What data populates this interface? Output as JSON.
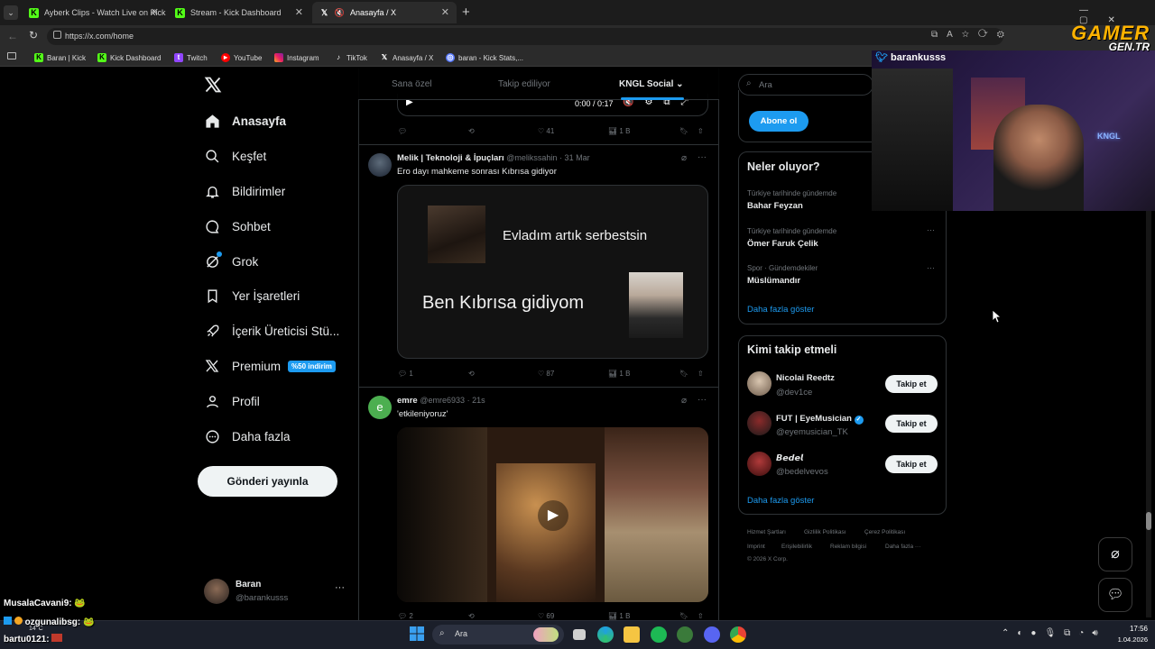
{
  "browser": {
    "tabs": [
      {
        "label": "Ayberk Clips - Watch Live on Kick",
        "favicon": "kick-icon",
        "color": "#53fc18"
      },
      {
        "label": "Stream - Kick Dashboard",
        "favicon": "kick-icon",
        "color": "#53fc18"
      },
      {
        "label": "Anasayfa / X",
        "favicon": "x-icon",
        "color": "#ffffff"
      }
    ],
    "url": "https://x.com/home",
    "bookmarks": [
      "Baran | Kick",
      "Kick Dashboard",
      "Twitch",
      "YouTube",
      "Instagram",
      "TikTok",
      "Anasayfa / X",
      "baran - Kick Stats,..."
    ]
  },
  "sidebar": {
    "items": [
      {
        "label": "Anasayfa",
        "icon": "home-icon"
      },
      {
        "label": "Keşfet",
        "icon": "search-icon"
      },
      {
        "label": "Bildirimler",
        "icon": "bell-icon"
      },
      {
        "label": "Sohbet",
        "icon": "chat-icon"
      },
      {
        "label": "Grok",
        "icon": "grok-icon"
      },
      {
        "label": "Yer İşaretleri",
        "icon": "bookmark-icon"
      },
      {
        "label": "İçerik Üreticisi Stü...",
        "icon": "rocket-icon"
      },
      {
        "label": "Premium",
        "icon": "x-icon"
      },
      {
        "label": "Profil",
        "icon": "user-icon"
      },
      {
        "label": "Daha fazla",
        "icon": "more-circle-icon"
      }
    ],
    "premium_badge": "%50 indirim",
    "post_button": "Gönderi yayınla",
    "account": {
      "name": "Baran",
      "handle": "@barankusss"
    }
  },
  "feed": {
    "tabs": [
      "Sana özel",
      "Takip ediliyor",
      "KNGL Social"
    ],
    "video_time": "0:00 / 0:17",
    "top_post_actions": {
      "likes": "41",
      "views": "1 B"
    },
    "posts": [
      {
        "name": "Melik | Teknoloji & İpuçları",
        "handle": "@melikssahin",
        "time": "· 31 Mar",
        "text": "Ero dayı mahkeme sonrası Kıbrısa gidiyor",
        "meme_line1": "Evladım artık serbestsin",
        "meme_line2": "Ben Kıbrısa gidiyom",
        "replies": "1",
        "likes": "87",
        "views": "1 B"
      },
      {
        "name": "emre",
        "handle": "@emre6933",
        "time": "· 21s",
        "text": "'etkileniyoruz'",
        "avatar_letter": "e",
        "replies": "2",
        "likes": "69",
        "views": "1 B"
      }
    ]
  },
  "right": {
    "search_placeholder": "Ara",
    "subscribe_button": "Abone ol",
    "trends_title": "Neler oluyor?",
    "trends": [
      {
        "context": "Türkiye tarihinde gündemde",
        "name": "Bahar Feyzan"
      },
      {
        "context": "Türkiye tarihinde gündemde",
        "name": "Ömer Faruk Çelik"
      },
      {
        "context": "Spor · Gündemdekiler",
        "name": "Müslümandır"
      }
    ],
    "show_more": "Daha fazla göster",
    "who_to_follow_title": "Kimi takip etmeli",
    "suggestions": [
      {
        "name": "Nicolai Reedtz",
        "handle": "@dev1ce"
      },
      {
        "name": "FUT | EyeMusician",
        "handle": "@eyemusician_TK",
        "verified": true
      },
      {
        "name": "𝘽𝙚𝙙𝙚𝙡",
        "handle": "@bedelvevos"
      }
    ],
    "follow_label": "Takip et",
    "footer": [
      "Hizmet Şartları",
      "Gizlilik Politikası",
      "Çerez Politikası",
      "Imprint",
      "Erişilebilirlik",
      "Reklam bilgisi",
      "Daha fazla ···",
      "© 2026 X Corp."
    ]
  },
  "overlay": {
    "watermark_line1": "GAMER",
    "watermark_line2": "GEN.TR",
    "cam_username": "barankusss",
    "chat": [
      {
        "user": "MusalaCavani9",
        "msg": ": 🐸"
      },
      {
        "user": "ozgunalibsg",
        "msg": ": 🐸"
      },
      {
        "user": "bartu0121",
        "msg": ":"
      }
    ]
  },
  "taskbar": {
    "search": "Ara",
    "weather": "14°C",
    "time": "17:56",
    "date": "1.04.2026"
  }
}
